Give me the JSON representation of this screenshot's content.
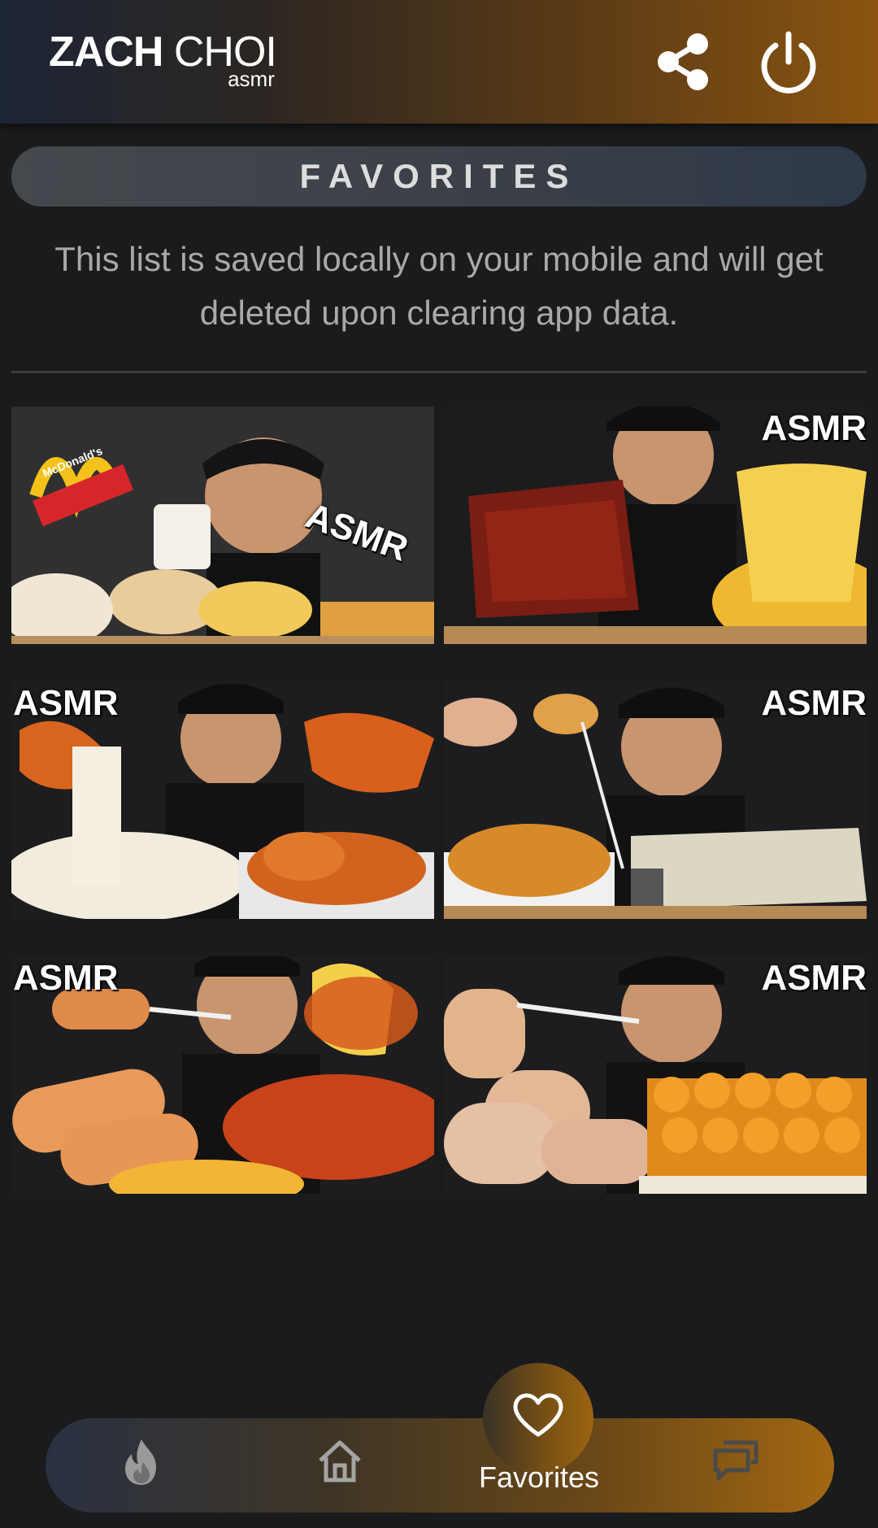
{
  "header": {
    "logo_main_bold": "ZACH",
    "logo_main_light": "CHOI",
    "logo_sub": "asmr",
    "icons": [
      "share-icon",
      "power-icon"
    ]
  },
  "page": {
    "title": "FAVORITES",
    "notice": "This list is saved locally on your mobile and will get deleted upon clearing app data."
  },
  "videos": [
    {
      "tag": "ASMR",
      "theme": "McDonald's breakfast"
    },
    {
      "tag": "ASMR",
      "theme": "ribs and cheese"
    },
    {
      "tag": "ASMR",
      "theme": "fried chicken with cheese"
    },
    {
      "tag": "ASMR",
      "theme": "fried chicken with cheese block"
    },
    {
      "tag": "ASMR",
      "theme": "corn dogs and fried chicken"
    },
    {
      "tag": "ASMR",
      "theme": "corn dogs and nuggets"
    }
  ],
  "thumb1_sign": "McDonald's",
  "nav": {
    "items": [
      {
        "name": "trending",
        "icon": "flame-icon"
      },
      {
        "name": "home",
        "icon": "home-icon"
      },
      {
        "name": "favorites",
        "icon": "heart-icon",
        "label": "Favorites"
      },
      {
        "name": "comments",
        "icon": "chat-icon"
      }
    ],
    "favorites_label": "Favorites",
    "accent": "#a26712"
  }
}
